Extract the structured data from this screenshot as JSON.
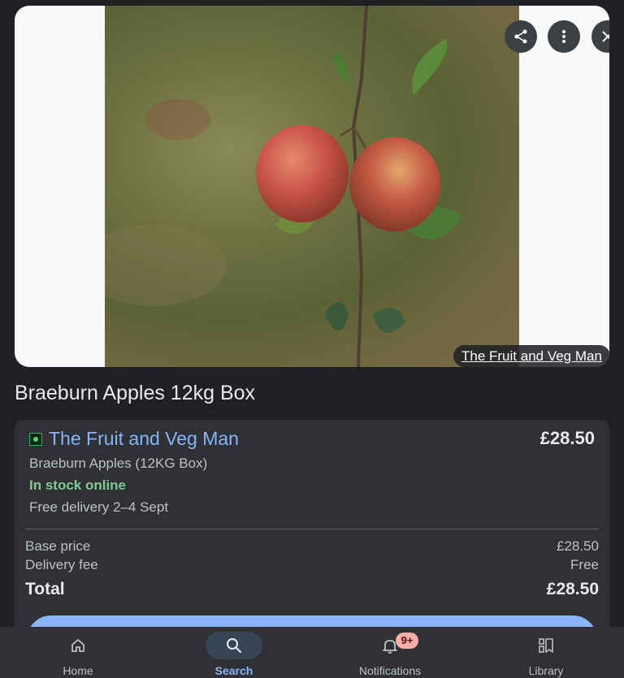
{
  "hero": {
    "credit": "The Fruit and Veg Man",
    "actions": {
      "share_icon": "share-icon",
      "more_icon": "more-vert-icon",
      "close_icon": "close-icon"
    }
  },
  "product": {
    "title": "Braeburn Apples 12kg Box"
  },
  "offer": {
    "store_name": "The Fruit and Veg Man",
    "price": "£28.50",
    "variant": "Braeburn Apples (12KG Box)",
    "stock": "In stock online",
    "delivery": "Free delivery 2–4 Sept",
    "breakdown": [
      {
        "label": "Base price",
        "value": "£28.50"
      },
      {
        "label": "Delivery fee",
        "value": "Free"
      }
    ],
    "total": {
      "label": "Total",
      "value": "£28.50"
    }
  },
  "nav": {
    "items": [
      {
        "label": "Home",
        "icon": "home-icon"
      },
      {
        "label": "Search",
        "icon": "search-icon"
      },
      {
        "label": "Notifications",
        "icon": "bell-icon",
        "badge": "9+"
      },
      {
        "label": "Library",
        "icon": "library-icon"
      }
    ]
  },
  "colors": {
    "accent": "#8ab4f8",
    "stock": "#81c995",
    "background": "#202124",
    "card": "#303134"
  }
}
